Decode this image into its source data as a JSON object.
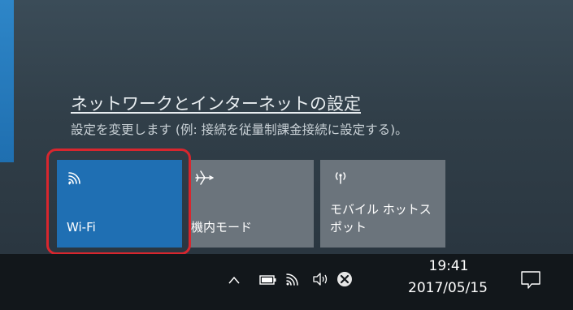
{
  "network_flyout": {
    "settings_link": "ネットワークとインターネットの設定",
    "settings_description": "設定を変更します (例: 接続を従量制課金接続に設定する)。",
    "tiles": [
      {
        "label": "Wi-Fi",
        "icon": "wifi-icon",
        "active": true
      },
      {
        "label": "機内モード",
        "icon": "airplane-icon",
        "active": false
      },
      {
        "label": "モバイル ホットス\nポット",
        "icon": "hotspot-icon",
        "active": false
      }
    ]
  },
  "taskbar": {
    "tray_icons": [
      "chevron-up-icon",
      "battery-icon",
      "wifi-icon",
      "volume-icon",
      "error-icon"
    ],
    "time": "19:41",
    "date": "2017/05/15",
    "notification_icon": "action-center-icon"
  },
  "colors": {
    "flyout_bg": "#313f49",
    "active_tile": "#1f6fb3",
    "inactive_tile": "#6b747c",
    "taskbar_bg": "#12171b",
    "highlight": "#d8262e"
  }
}
